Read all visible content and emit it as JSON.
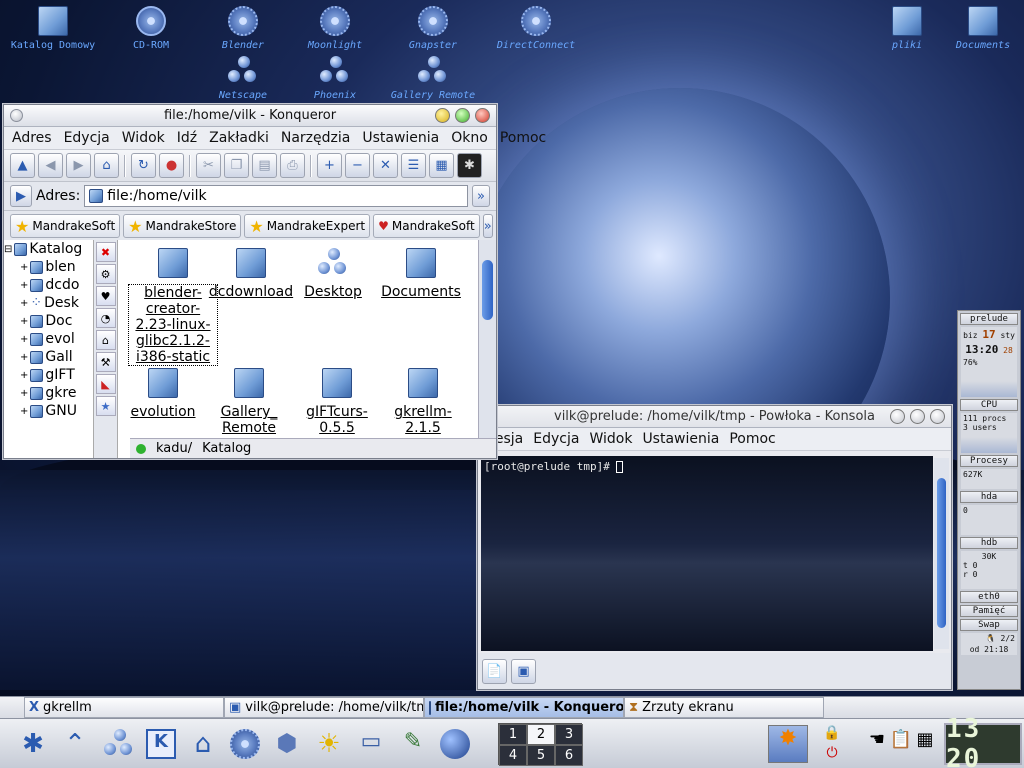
{
  "desktop": {
    "icons": [
      {
        "label": "Katalog Domowy",
        "icon": "home-folder-icon"
      },
      {
        "label": "CD-ROM",
        "icon": "cdrom-icon"
      },
      {
        "label": "Blender",
        "icon": "gear-icon"
      },
      {
        "label": "Moonlight",
        "icon": "gear-icon"
      },
      {
        "label": "Gnapster",
        "icon": "gear-icon"
      },
      {
        "label": "DirectConnect",
        "icon": "gear-icon"
      },
      {
        "label": "Netscape",
        "icon": "balls-icon"
      },
      {
        "label": "Phoenix",
        "icon": "balls-icon"
      },
      {
        "label": "Gallery Remote",
        "icon": "balls-icon"
      },
      {
        "label": "pliki",
        "icon": "folder-icon"
      },
      {
        "label": "Documents",
        "icon": "folder-icon"
      }
    ]
  },
  "konqueror": {
    "title": "file:/home/vilk - Konqueror",
    "menu": [
      "Adres",
      "Edycja",
      "Widok",
      "Idź",
      "Zakładki",
      "Narzędzia",
      "Ustawienia",
      "Okno",
      "Pomoc"
    ],
    "address_label": "Adres:",
    "address_value": "file:/home/vilk",
    "bookmarks": [
      "MandrakeSoft",
      "MandrakeStore",
      "MandrakeExpert",
      "MandrakeSoft"
    ],
    "tree": [
      "Katalog",
      "blen",
      "dcdo",
      "Desk",
      "Doc",
      "evol",
      "Gall",
      "gIFT",
      "gkre",
      "GNU"
    ],
    "files": [
      {
        "label": "blender-creator-2.23-linux-glibc2.1.2-i386-static",
        "selected": true
      },
      {
        "label": "dcdownload"
      },
      {
        "label": "Desktop",
        "icon": "balls-icon"
      },
      {
        "label": "Documents"
      },
      {
        "label": "evolution"
      },
      {
        "label": "Gallery_ Remote"
      },
      {
        "label": "gIFTcurs-0.5.5"
      },
      {
        "label": "gkrellm-2.1.5"
      }
    ],
    "status_left": "kadu/",
    "status_right": "Katalog"
  },
  "konsole": {
    "title": "vilk@prelude: /home/vilk/tmp - Powłoka - Konsola",
    "menu": [
      "Sesja",
      "Edycja",
      "Widok",
      "Ustawienia",
      "Pomoc"
    ],
    "prompt": "[root@prelude tmp]# "
  },
  "gkrellm": {
    "host": "prelude",
    "date_day": "biz",
    "date_num": "17",
    "date_month": "sty",
    "time": "13:20",
    "seconds": "28",
    "cpu_pct": "76%",
    "cpu_label": "CPU",
    "procs": "111 procs",
    "users": "3 users",
    "proc_label": "Procesy",
    "proc_val": "627K",
    "hda_label": "hda",
    "hda_val": "0",
    "hdb_label": "hdb",
    "hdb_val": "30K",
    "hdb_t": "t 0",
    "hdb_r": "r 0",
    "eth_label": "eth0",
    "mem_label": "Pamięć",
    "swap_label": "Swap",
    "mail": "2/2",
    "uptime": "od 21:18"
  },
  "taskbar": {
    "tasks": [
      {
        "label": "gkrellm",
        "icon": "x-icon"
      },
      {
        "label": "vilk@prelude: /home/vilk/tmp",
        "icon": "konsole-icon"
      },
      {
        "label": "file:/home/vilk - Konquero",
        "icon": "folder-icon",
        "active": true
      },
      {
        "label": "Zrzuty ekranu",
        "icon": "hourglass-icon"
      }
    ]
  },
  "panel": {
    "pager": [
      "1",
      "2",
      "3",
      "4",
      "5",
      "6"
    ],
    "current_desktop": "2",
    "clock": "13 20"
  }
}
